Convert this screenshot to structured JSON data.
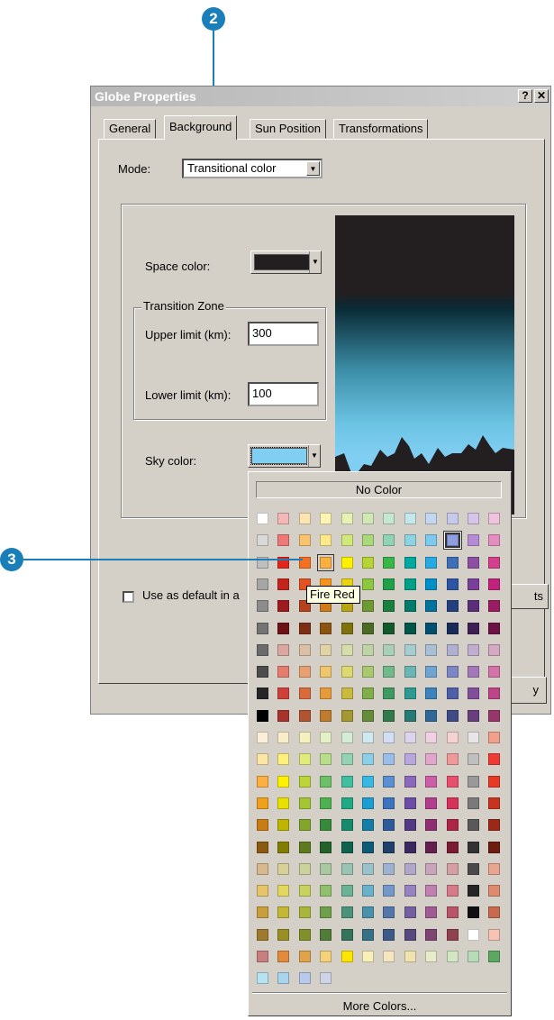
{
  "callouts": {
    "step2": "2",
    "step3": "3"
  },
  "dialog": {
    "title": "Globe Properties",
    "help_button": "?",
    "close_button": "✕",
    "tabs": [
      {
        "label": "General",
        "active": false
      },
      {
        "label": "Background",
        "active": true
      },
      {
        "label": "Sun Position",
        "active": false
      },
      {
        "label": "Transformations",
        "active": false
      }
    ],
    "mode": {
      "label": "Mode:",
      "value": "Transitional color"
    },
    "space_color": {
      "label": "Space color:",
      "color": "#231f20"
    },
    "transition_zone": {
      "title": "Transition Zone",
      "upper_label": "Upper limit (km):",
      "upper_value": "300",
      "lower_label": "Lower limit (km):",
      "lower_value": "100"
    },
    "sky_color": {
      "label": "Sky color:",
      "color": "#80cef2"
    },
    "default_checkbox_label": "Use as default in a",
    "defaults_button_partial": "ts",
    "bottom_button_partial": "y"
  },
  "palette": {
    "no_color": "No Color",
    "more_colors": "More Colors...",
    "tooltip": "Fire Red",
    "rows": [
      [
        "#ffffff",
        "#f3b7b7",
        "#fce4b5",
        "#fdf4b5",
        "#e6f2b5",
        "#cfe8b5",
        "#c4e6d2",
        "#c5e6ea",
        "#c4d7f0",
        "#c7c9ea",
        "#d6c5e8",
        "#efc2dd"
      ],
      [
        "#d9d9d9",
        "#ed7878",
        "#f9c46f",
        "#fde98a",
        "#d3e87a",
        "#a9d97a",
        "#8fd4b6",
        "#8fd3e2",
        "#7dc9f0",
        "#8f9ee0",
        "#b48bd4",
        "#e58cc1"
      ],
      [
        "#bfbfbf",
        "#e3261c",
        "#f37021",
        "#fbb040",
        "#fff200",
        "#b6d433",
        "#39b54a",
        "#00a99d",
        "#27aae1",
        "#3f6fb6",
        "#8c4fa3",
        "#d43f8d"
      ],
      [
        "#a6a6a6",
        "#c4241c",
        "#e2511f",
        "#f7941d",
        "#ebd410",
        "#8dc63f",
        "#21a04a",
        "#009f88",
        "#0090c8",
        "#2e55a3",
        "#7a3f9a",
        "#c0237c"
      ],
      [
        "#8c8c8c",
        "#9e1b20",
        "#b4421e",
        "#cc7a1a",
        "#b8a512",
        "#6e9a32",
        "#1b7f3e",
        "#007a6b",
        "#00729e",
        "#243f80",
        "#5b2e7a",
        "#9a1c62"
      ],
      [
        "#737373",
        "#6d1215",
        "#7d2e14",
        "#8c5412",
        "#7f720d",
        "#4b6b23",
        "#13592b",
        "#00554a",
        "#004f6e",
        "#192b59",
        "#3f2055",
        "#6b1344"
      ],
      [
        "#6b6b6b",
        "#d9a6a0",
        "#dcc0a6",
        "#e0d3a6",
        "#d6dcaa",
        "#bfd4a6",
        "#a9cfb8",
        "#a6ccd2",
        "#a9bfd6",
        "#b0b1d2",
        "#c0add0",
        "#d5a9c4"
      ],
      [
        "#4d4d4d",
        "#e57c6e",
        "#e9a071",
        "#efc56d",
        "#dcd971",
        "#a9c870",
        "#71b98a",
        "#6bb5b4",
        "#6fa3d0",
        "#7d86c2",
        "#a278b8",
        "#d373a7"
      ],
      [
        "#262626",
        "#d0403a",
        "#d96a3c",
        "#e69a3a",
        "#c9bb3f",
        "#7fae4a",
        "#3f9a62",
        "#2f9a91",
        "#3c83bd",
        "#4e5fa8",
        "#824f9d",
        "#bd4486"
      ],
      [
        "#000000",
        "#a8332e",
        "#b25430",
        "#bf7c2e",
        "#a39832",
        "#658c3b",
        "#32794e",
        "#257a73",
        "#2f6896",
        "#3e4b85",
        "#673f7d",
        "#96366a"
      ],
      [
        "#fcefd9",
        "#f9ecc8",
        "#f5f0c0",
        "#e5f0c6",
        "#d4ecd6",
        "#cfe9ee",
        "#d2def2",
        "#dcd3ec",
        "#f0d1e4",
        "#f6d3d3",
        "#e6e6e6",
        "#f0a08c"
      ],
      [
        "#fde6a5",
        "#fdf07c",
        "#e0ec7c",
        "#b8de8a",
        "#93d3b3",
        "#8ad0e6",
        "#9bbde9",
        "#b8a7dc",
        "#e1a6cc",
        "#ef9a9a",
        "#bfbfbf",
        "#ee3b33"
      ],
      [
        "#fbb040",
        "#fff200",
        "#bcd63a",
        "#6dc066",
        "#3fbfa0",
        "#36b8e2",
        "#5b8fd1",
        "#8c68bd",
        "#cc5ea8",
        "#e94e6e",
        "#999999",
        "#e63b24"
      ],
      [
        "#f0a01b",
        "#e8e000",
        "#a3c635",
        "#4eb04f",
        "#1fa987",
        "#1a9dd0",
        "#3d73be",
        "#6d4ca5",
        "#b23e8e",
        "#d7325a",
        "#7a7a7a",
        "#c8331e"
      ],
      [
        "#c77d14",
        "#bdb500",
        "#82a62b",
        "#378a3c",
        "#158a6c",
        "#137fa8",
        "#2d5b99",
        "#543a85",
        "#8e2f72",
        "#ad2648",
        "#595959",
        "#9c2817"
      ],
      [
        "#8a5a0f",
        "#827c00",
        "#5d7a1f",
        "#25622b",
        "#0f634e",
        "#0e5b78",
        "#1f3f6c",
        "#3a285e",
        "#631f50",
        "#7a1a33",
        "#333333",
        "#6e1c10"
      ],
      [
        "#d8b98f",
        "#d8d09a",
        "#cbd39c",
        "#aac8a0",
        "#99c4b3",
        "#9ac2cd",
        "#9fb2cf",
        "#afa6c9",
        "#c9a4bd",
        "#d39fa5",
        "#4a4a4a",
        "#e8a58f"
      ],
      [
        "#e6c46a",
        "#e2d860",
        "#c7d35e",
        "#90c06b",
        "#6bb396",
        "#68b1c8",
        "#7598c8",
        "#9582bf",
        "#c07fb1",
        "#d47a89",
        "#262626",
        "#dd8a6e"
      ],
      [
        "#c99f3e",
        "#c3b836",
        "#a8b63c",
        "#6ea04b",
        "#4a9278",
        "#4791ab",
        "#5476ab",
        "#7460a1",
        "#a05b92",
        "#b85568",
        "#101010",
        "#c96a4c"
      ],
      [
        "#9d7a2e",
        "#988f27",
        "#82902c",
        "#527d39",
        "#36735d",
        "#357187",
        "#3f5a86",
        "#58497e",
        "#7d4572",
        "#8f4150",
        "#ffffff",
        "#f6c3b5"
      ],
      [
        "#c87f7f",
        "#e38b3c",
        "#e0a24a",
        "#f4d27a",
        "#ffe600",
        "#f7f0b8",
        "#f5e6c2",
        "#efe3b0",
        "#e6ecc9",
        "#d3e6c4",
        "#b9dcb8",
        "#5aa862"
      ],
      [
        "#b7e3f0",
        "#a8d4ec",
        "#b9c9ec",
        "#cfd3e6"
      ]
    ],
    "selected_color": "#80cef2",
    "hovered_color": "#e3261c"
  }
}
